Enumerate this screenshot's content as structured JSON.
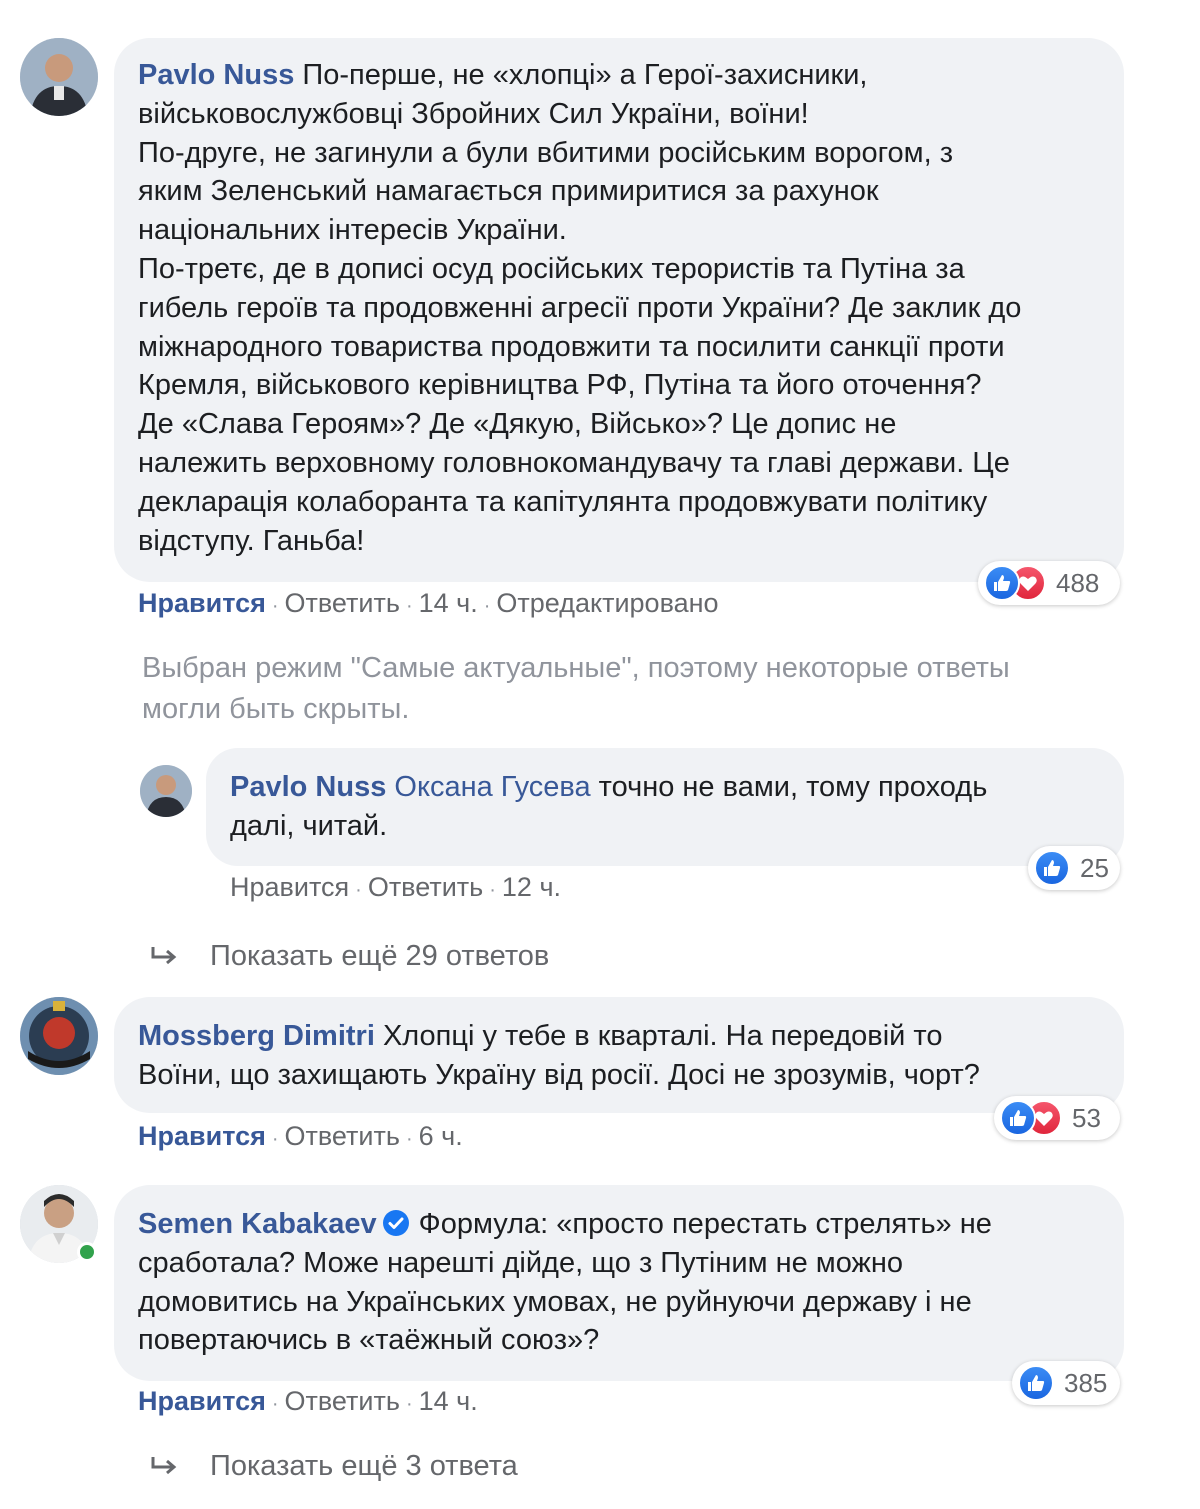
{
  "comments": [
    {
      "author": "Pavlo Nuss",
      "text_lines": [
        "По-перше, не «хлопці» а Герої-захисники,",
        "військовослужбовці Збройних Сил України, воїни!",
        "По-друге, не загинули а були вбитими російським ворогом, з",
        "яким Зеленський намагається примиритися за рахунок",
        "національних інтересів України.",
        "По-третє, де в дописі осуд російських терористів та Путіна за",
        "гибель героїв та продовженні агресії проти України? Де заклик до",
        "міжнародного товариства продовжити та посилити санкції проти",
        "Кремля, військового керівництва РФ, Путіна та його оточення?",
        "Де «Слава Героям»? Де «Дякую, Військо»? Це допис не",
        "належить верховному головнокомандувачу та главі держави. Це",
        "декларація колаборанта та капітулянта продовжувати політику",
        "відступу. Ганьба!"
      ],
      "reaction_count": "488",
      "like_label": "Нравится",
      "reply_label": "Ответить",
      "time": "14 ч.",
      "edited_label": "Отредактировано"
    },
    {
      "author": "Mossberg Dimitri",
      "text_lines": [
        "Хлопці у тебе в кварталі. На передовій то",
        "Воїни, що захищають Україну від росії. Досі не зрозумів, чорт?"
      ],
      "reaction_count": "53",
      "like_label": "Нравится",
      "reply_label": "Ответить",
      "time": "6 ч."
    },
    {
      "author": "Semen Kabakaev",
      "text_lines": [
        "Формула: «просто перестать стрелять» не",
        "сработала? Може нарешті дійде, що з Путіним не можно",
        "домовитись на Українських умовах, не руйнуючи державу і не",
        "повертаючись в «таёжный союз»?"
      ],
      "reaction_count": "385",
      "like_label": "Нравится",
      "reply_label": "Ответить",
      "time": "14 ч."
    }
  ],
  "notice_lines": [
    "Выбран режим \"Самые актуальные\", поэтому некоторые ответы",
    "могли быть скрыты."
  ],
  "reply": {
    "author": "Pavlo Nuss",
    "mention": "Оксана Гусева",
    "text_lines": [
      "точно не вами, тому проходь",
      "далі, читай."
    ],
    "reaction_count": "25",
    "like_label": "Нравится",
    "reply_label": "Ответить",
    "time": "12 ч."
  },
  "more_replies": [
    "Показать ещё 29 ответов",
    "Показать ещё 3 ответа"
  ],
  "colors": {
    "author_link": "#385898",
    "bubble_bg": "#f0f2f5",
    "meta_text": "#65676b",
    "like_blue": "#1a66e0",
    "love_red": "#e0263c",
    "online_green": "#31a24c"
  }
}
